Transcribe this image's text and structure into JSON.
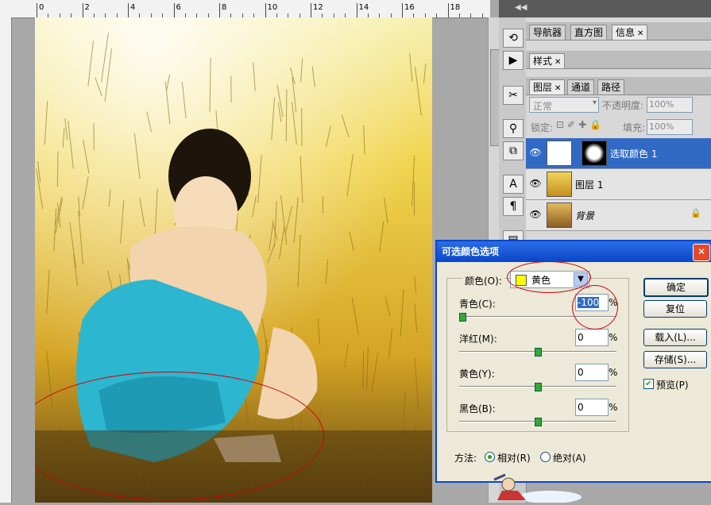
{
  "ruler": {
    "ticks": [
      "0",
      "2",
      "4",
      "6",
      "8",
      "10",
      "12",
      "14",
      "16",
      "18"
    ]
  },
  "panels": {
    "top_tabs": [
      {
        "label": "导航器"
      },
      {
        "label": "直方图"
      },
      {
        "label": "信息"
      }
    ],
    "style_tab": {
      "label": "样式"
    },
    "layer_tabs": [
      {
        "label": "图层"
      },
      {
        "label": "通道"
      },
      {
        "label": "路径"
      }
    ],
    "blend_mode": "正常",
    "opacity_label": "不透明度:",
    "opacity_value": "100%",
    "lock_label": "锁定:",
    "fill_label": "填充:",
    "fill_value": "100%",
    "layers": [
      {
        "name": "选取颜色 1",
        "selected": true
      },
      {
        "name": "图层 1",
        "selected": false
      },
      {
        "name": "背景",
        "selected": false
      }
    ]
  },
  "dialog": {
    "title": "可选颜色选项",
    "colors_label": "颜色(O):",
    "colors_value": "黄色",
    "swatch_color": "#ffff00",
    "sliders": [
      {
        "label": "青色(C):",
        "value": "-100",
        "unit": "%",
        "level": 0.0
      },
      {
        "label": "洋红(M):",
        "value": "0",
        "unit": "%",
        "level": 0.5
      },
      {
        "label": "黄色(Y):",
        "value": "0",
        "unit": "%",
        "level": 0.5
      },
      {
        "label": "黑色(B):",
        "value": "0",
        "unit": "%",
        "level": 0.5
      }
    ],
    "buttons": {
      "ok": "确定",
      "reset": "复位",
      "load": "载入(L)...",
      "save": "存储(S)..."
    },
    "preview_label": "预览(P)",
    "preview_checked": true,
    "method_label": "方法:",
    "method_relative": "相对(R)",
    "method_absolute": "绝对(A)"
  },
  "colors": {
    "accent": "#0a46c8",
    "annotation": "#d40000",
    "layer_selected": "#316ac5"
  }
}
